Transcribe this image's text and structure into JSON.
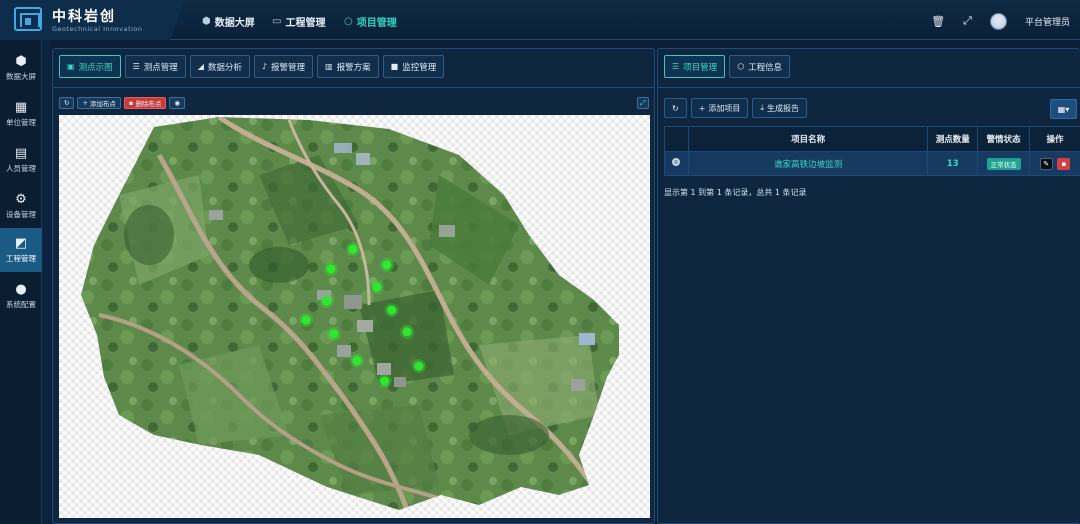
{
  "brand": {
    "name": "中科岩创",
    "tagline": "Geotechnical Innovation"
  },
  "topnav": [
    {
      "label": "数据大屏",
      "icon": "cube-icon"
    },
    {
      "label": "工程管理",
      "icon": "monitor-icon"
    },
    {
      "label": "项目管理",
      "icon": "circle-icon",
      "active": true
    }
  ],
  "user": {
    "name": "平台管理员"
  },
  "sidebar": {
    "items": [
      {
        "label": "数据大屏",
        "icon": "cube-icon"
      },
      {
        "label": "单位管理",
        "icon": "calendar-check-icon"
      },
      {
        "label": "人员管理",
        "icon": "id-card-icon"
      },
      {
        "label": "设备管理",
        "icon": "gear-icon"
      },
      {
        "label": "工程管理",
        "icon": "chart-image-icon",
        "active": true
      },
      {
        "label": "系统配置",
        "icon": "more-dots-icon"
      }
    ]
  },
  "left_tabs": [
    {
      "label": "测点示图",
      "icon": "image-icon",
      "active": true
    },
    {
      "label": "测点管理",
      "icon": "list-icon"
    },
    {
      "label": "数据分析",
      "icon": "area-chart-icon"
    },
    {
      "label": "报警管理",
      "icon": "bell-icon"
    },
    {
      "label": "报警方案",
      "icon": "book-icon"
    },
    {
      "label": "监控管理",
      "icon": "video-icon"
    }
  ],
  "map_toolbar": {
    "add_point": "添加布点",
    "delete_point": "删除布点"
  },
  "map": {
    "point_color": "#2ee82e",
    "points": [
      {
        "x": 0.497,
        "y": 0.333
      },
      {
        "x": 0.555,
        "y": 0.372
      },
      {
        "x": 0.46,
        "y": 0.382
      },
      {
        "x": 0.538,
        "y": 0.427
      },
      {
        "x": 0.453,
        "y": 0.462
      },
      {
        "x": 0.563,
        "y": 0.484
      },
      {
        "x": 0.418,
        "y": 0.509
      },
      {
        "x": 0.465,
        "y": 0.543
      },
      {
        "x": 0.589,
        "y": 0.538
      },
      {
        "x": 0.504,
        "y": 0.61
      },
      {
        "x": 0.609,
        "y": 0.623
      },
      {
        "x": 0.551,
        "y": 0.66
      }
    ]
  },
  "right_tabs": [
    {
      "label": "项目管理",
      "icon": "list-icon",
      "active": true
    },
    {
      "label": "工程信息",
      "icon": "cubes-icon"
    }
  ],
  "right_toolbar": {
    "add_project": "添加项目",
    "generate_report": "生成报告"
  },
  "table": {
    "headers": [
      "",
      "项目名称",
      "测点数量",
      "警情状态",
      "操作"
    ],
    "rows": [
      {
        "name": "谯家高铁边坡监测",
        "count": "13",
        "status": "正常状态"
      }
    ]
  },
  "pager_text": "显示第 1 到第 1 条记录，总共 1 条记录"
}
